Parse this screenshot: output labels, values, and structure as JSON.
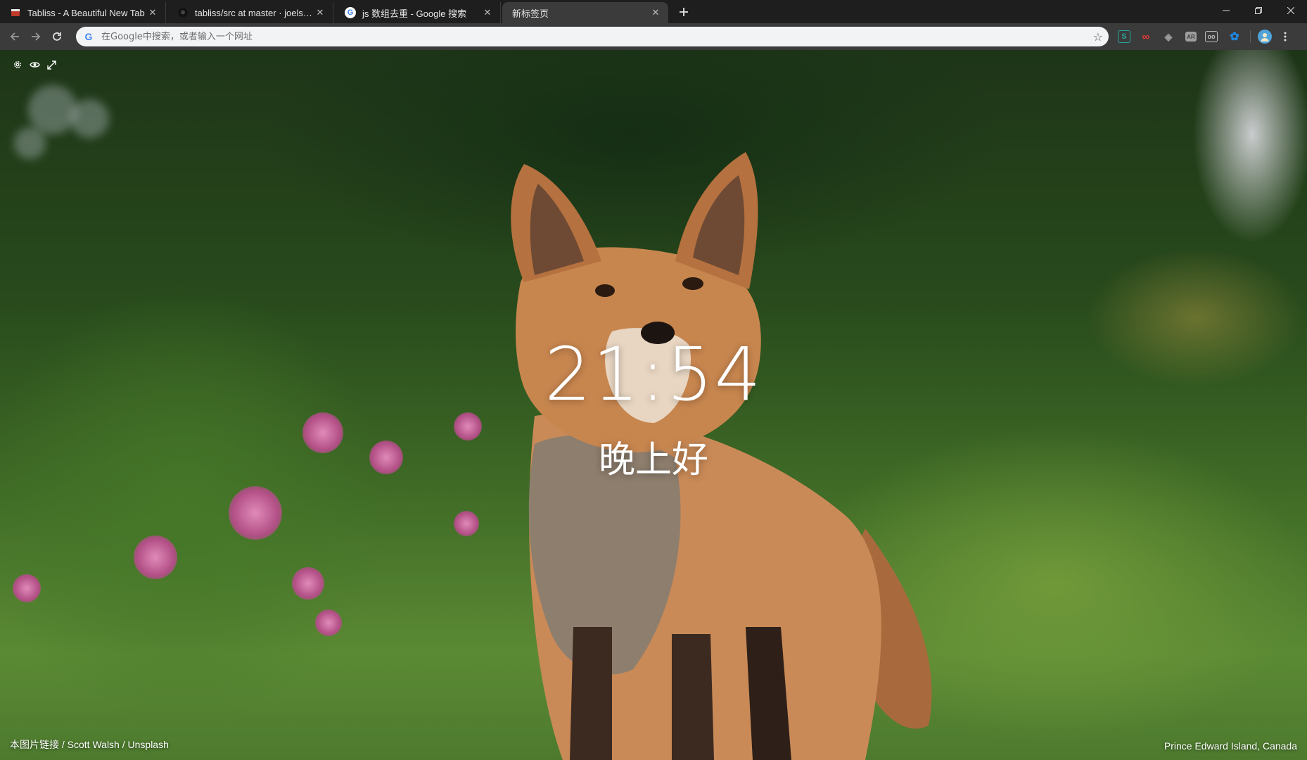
{
  "tabs": [
    {
      "title": "Tabliss - A Beautiful New Tab",
      "active": false,
      "favicon": "tabliss-icon",
      "favicon_color": "#c0392b"
    },
    {
      "title": "tabliss/src at master · joelshepherd",
      "active": false,
      "favicon": "github-icon",
      "favicon_color": "#111111"
    },
    {
      "title": "js 数组去重 - Google 搜索",
      "active": false,
      "favicon": "google-icon",
      "favicon_color": "#4285f4"
    },
    {
      "title": "新标签页",
      "active": true,
      "favicon": "",
      "favicon_color": ""
    }
  ],
  "omnibox": {
    "placeholder": "在Google中搜索，或者输入一个网址"
  },
  "extensions": [
    {
      "name": "s-extension-icon",
      "glyph": "S",
      "color": "#26a69a"
    },
    {
      "name": "glasses-extension-icon",
      "glyph": "∞",
      "color": "#e53935"
    },
    {
      "name": "shield-extension-icon",
      "glyph": "◈",
      "color": "#9e9e9e"
    },
    {
      "name": "ar-extension-icon",
      "glyph": "AR",
      "color": "#9e9e9e"
    },
    {
      "name": "oo-extension-icon",
      "glyph": "oo",
      "color": "#bdbdbd"
    },
    {
      "name": "flower-extension-icon",
      "glyph": "✿",
      "color": "#1e88e5"
    }
  ],
  "clock": {
    "time": "21:54"
  },
  "greeting": {
    "text": "晚上好"
  },
  "credit": {
    "prefix": "本图片链接",
    "separator1": " / ",
    "author": "Scott Walsh",
    "separator2": " / ",
    "source": "Unsplash"
  },
  "location": {
    "text": "Prince Edward Island, Canada"
  },
  "colors": {
    "tab_bg": "#1e1e1e",
    "toolbar_bg": "#3b3b3b",
    "omnibox_bg": "#f1f3f4"
  }
}
